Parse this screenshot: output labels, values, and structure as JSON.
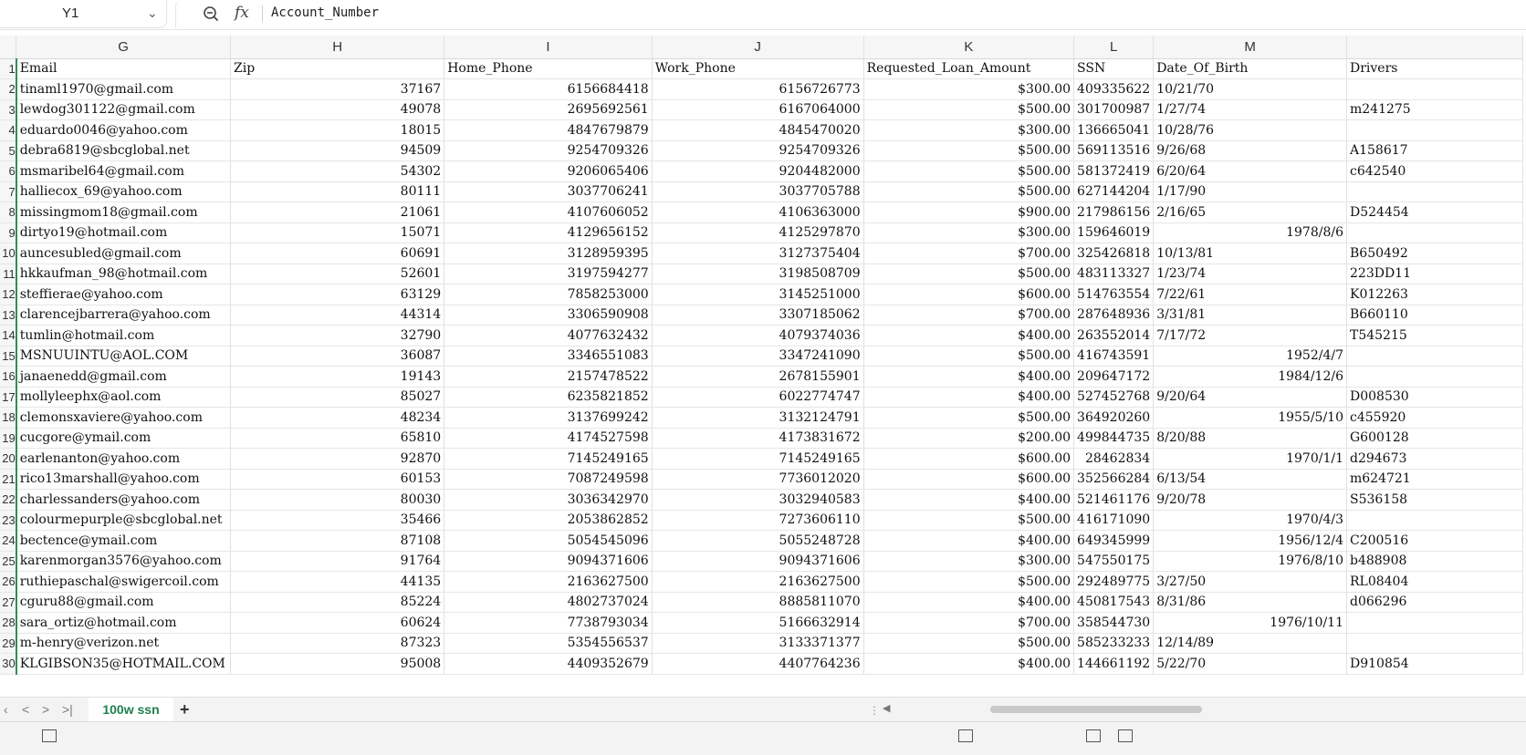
{
  "name_box": {
    "value": "Y1",
    "chevron": "chevron-down-icon"
  },
  "formula_bar": {
    "zoom_icon": "magnifier-icon",
    "fx_label": "fx",
    "value": "Account_Number"
  },
  "column_headers": [
    "G",
    "H",
    "I",
    "J",
    "K",
    "L",
    "M",
    ""
  ],
  "header_row": {
    "row_number": "1",
    "cells": [
      "Email",
      "Zip",
      "Home_Phone",
      "Work_Phone",
      "Requested_Loan_Amount",
      "SSN",
      "Date_Of_Birth",
      "Drivers"
    ]
  },
  "rows": [
    {
      "n": "2",
      "email": "tinaml1970@gmail.com",
      "zip": "37167",
      "home": "6156684418",
      "work": "6156726773",
      "loan": "$300.00",
      "ssn": "409335622",
      "dob": "10/21/70",
      "dob_align": "left",
      "dl": ""
    },
    {
      "n": "3",
      "email": "lewdog301122@gmail.com",
      "zip": "49078",
      "home": "2695692561",
      "work": "6167064000",
      "loan": "$500.00",
      "ssn": "301700987",
      "dob": "1/27/74",
      "dob_align": "left",
      "dl": "m241275"
    },
    {
      "n": "4",
      "email": "eduardo0046@yahoo.com",
      "zip": "18015",
      "home": "4847679879",
      "work": "4845470020",
      "loan": "$300.00",
      "ssn": "136665041",
      "dob": "10/28/76",
      "dob_align": "left",
      "dl": ""
    },
    {
      "n": "5",
      "email": "debra6819@sbcglobal.net",
      "zip": "94509",
      "home": "9254709326",
      "work": "9254709326",
      "loan": "$500.00",
      "ssn": "569113516",
      "dob": "9/26/68",
      "dob_align": "left",
      "dl": "A158617"
    },
    {
      "n": "6",
      "email": "msmaribel64@gmail.com",
      "zip": "54302",
      "home": "9206065406",
      "work": "9204482000",
      "loan": "$500.00",
      "ssn": "581372419",
      "dob": "6/20/64",
      "dob_align": "left",
      "dl": "c642540"
    },
    {
      "n": "7",
      "email": "halliecox_69@yahoo.com",
      "zip": "80111",
      "home": "3037706241",
      "work": "3037705788",
      "loan": "$500.00",
      "ssn": "627144204",
      "dob": "1/17/90",
      "dob_align": "left",
      "dl": ""
    },
    {
      "n": "8",
      "email": "missingmom18@gmail.com",
      "zip": "21061",
      "home": "4107606052",
      "work": "4106363000",
      "loan": "$900.00",
      "ssn": "217986156",
      "dob": "2/16/65",
      "dob_align": "left",
      "dl": "D524454"
    },
    {
      "n": "9",
      "email": "dirtyo19@hotmail.com",
      "zip": "15071",
      "home": "4129656152",
      "work": "4125297870",
      "loan": "$300.00",
      "ssn": "159646019",
      "dob": "1978/8/6",
      "dob_align": "right",
      "dl": ""
    },
    {
      "n": "10",
      "email": "auncesubled@gmail.com",
      "zip": "60691",
      "home": "3128959395",
      "work": "3127375404",
      "loan": "$700.00",
      "ssn": "325426818",
      "dob": "10/13/81",
      "dob_align": "left",
      "dl": "B650492"
    },
    {
      "n": "11",
      "email": "hkkaufman_98@hotmail.com",
      "zip": "52601",
      "home": "3197594277",
      "work": "3198508709",
      "loan": "$500.00",
      "ssn": "483113327",
      "dob": "1/23/74",
      "dob_align": "left",
      "dl": "223DD11"
    },
    {
      "n": "12",
      "email": "steffierae@yahoo.com",
      "zip": "63129",
      "home": "7858253000",
      "work": "3145251000",
      "loan": "$600.00",
      "ssn": "514763554",
      "dob": "7/22/61",
      "dob_align": "left",
      "dl": "K012263"
    },
    {
      "n": "13",
      "email": "clarencejbarrera@yahoo.com",
      "zip": "44314",
      "home": "3306590908",
      "work": "3307185062",
      "loan": "$700.00",
      "ssn": "287648936",
      "dob": "3/31/81",
      "dob_align": "left",
      "dl": "B660110"
    },
    {
      "n": "14",
      "email": "tumlin@hotmail.com",
      "zip": "32790",
      "home": "4077632432",
      "work": "4079374036",
      "loan": "$400.00",
      "ssn": "263552014",
      "dob": "7/17/72",
      "dob_align": "left",
      "dl": "T545215"
    },
    {
      "n": "15",
      "email": "MSNUUINTU@AOL.COM",
      "zip": "36087",
      "home": "3346551083",
      "work": "3347241090",
      "loan": "$500.00",
      "ssn": "416743591",
      "dob": "1952/4/7",
      "dob_align": "right",
      "dl": ""
    },
    {
      "n": "16",
      "email": "janaenedd@gmail.com",
      "zip": "19143",
      "home": "2157478522",
      "work": "2678155901",
      "loan": "$400.00",
      "ssn": "209647172",
      "dob": "1984/12/6",
      "dob_align": "right",
      "dl": ""
    },
    {
      "n": "17",
      "email": "mollyleephx@aol.com",
      "zip": "85027",
      "home": "6235821852",
      "work": "6022774747",
      "loan": "$400.00",
      "ssn": "527452768",
      "dob": "9/20/64",
      "dob_align": "left",
      "dl": "D008530"
    },
    {
      "n": "18",
      "email": "clemonsxaviere@yahoo.com",
      "zip": "48234",
      "home": "3137699242",
      "work": "3132124791",
      "loan": "$500.00",
      "ssn": "364920260",
      "dob": "1955/5/10",
      "dob_align": "right",
      "dl": "c455920"
    },
    {
      "n": "19",
      "email": "cucgore@ymail.com",
      "zip": "65810",
      "home": "4174527598",
      "work": "4173831672",
      "loan": "$200.00",
      "ssn": "499844735",
      "dob": "8/20/88",
      "dob_align": "left",
      "dl": "G600128"
    },
    {
      "n": "20",
      "email": "earlenanton@yahoo.com",
      "zip": "92870",
      "home": "7145249165",
      "work": "7145249165",
      "loan": "$600.00",
      "ssn": "28462834",
      "dob": "1970/1/1",
      "dob_align": "right",
      "dl": "d294673"
    },
    {
      "n": "21",
      "email": "rico13marshall@yahoo.com",
      "zip": "60153",
      "home": "7087249598",
      "work": "7736012020",
      "loan": "$600.00",
      "ssn": "352566284",
      "dob": "6/13/54",
      "dob_align": "left",
      "dl": "m624721"
    },
    {
      "n": "22",
      "email": "charlessanders@yahoo.com",
      "zip": "80030",
      "home": "3036342970",
      "work": "3032940583",
      "loan": "$400.00",
      "ssn": "521461176",
      "dob": "9/20/78",
      "dob_align": "left",
      "dl": "S536158"
    },
    {
      "n": "23",
      "email": "colourmepurple@sbcglobal.net",
      "zip": "35466",
      "home": "2053862852",
      "work": "7273606110",
      "loan": "$500.00",
      "ssn": "416171090",
      "dob": "1970/4/3",
      "dob_align": "right",
      "dl": ""
    },
    {
      "n": "24",
      "email": "bectence@ymail.com",
      "zip": "87108",
      "home": "5054545096",
      "work": "5055248728",
      "loan": "$400.00",
      "ssn": "649345999",
      "dob": "1956/12/4",
      "dob_align": "right",
      "dl": "C200516"
    },
    {
      "n": "25",
      "email": "karenmorgan3576@yahoo.com",
      "zip": "91764",
      "home": "9094371606",
      "work": "9094371606",
      "loan": "$300.00",
      "ssn": "547550175",
      "dob": "1976/8/10",
      "dob_align": "right",
      "dl": "b488908"
    },
    {
      "n": "26",
      "email": "ruthiepaschal@swigercoil.com",
      "zip": "44135",
      "home": "2163627500",
      "work": "2163627500",
      "loan": "$500.00",
      "ssn": "292489775",
      "dob": "3/27/50",
      "dob_align": "left",
      "dl": "RL08404"
    },
    {
      "n": "27",
      "email": "cguru88@gmail.com",
      "zip": "85224",
      "home": "4802737024",
      "work": "8885811070",
      "loan": "$400.00",
      "ssn": "450817543",
      "dob": "8/31/86",
      "dob_align": "left",
      "dl": "d066296"
    },
    {
      "n": "28",
      "email": "sara_ortiz@hotmail.com",
      "zip": "60624",
      "home": "7738793034",
      "work": "5166632914",
      "loan": "$700.00",
      "ssn": "358544730",
      "dob": "1976/10/11",
      "dob_align": "right",
      "dl": ""
    },
    {
      "n": "29",
      "email": "m-henry@verizon.net",
      "zip": "87323",
      "home": "5354556537",
      "work": "3133371377",
      "loan": "$500.00",
      "ssn": "585233233",
      "dob": "12/14/89",
      "dob_align": "left",
      "dl": ""
    },
    {
      "n": "30",
      "email": "KLGIBSON35@HOTMAIL.COM",
      "zip": "95008",
      "home": "4409352679",
      "work": "4407764236",
      "loan": "$400.00",
      "ssn": "144661192",
      "dob": "5/22/70",
      "dob_align": "left",
      "dl": "D910854"
    }
  ],
  "tabs": {
    "sheet_name": "100w ssn",
    "add_label": "+"
  },
  "colors": {
    "accent": "#1e9e5a",
    "header_bg": "#f6f6f6",
    "gridline": "#e1e1e1"
  }
}
